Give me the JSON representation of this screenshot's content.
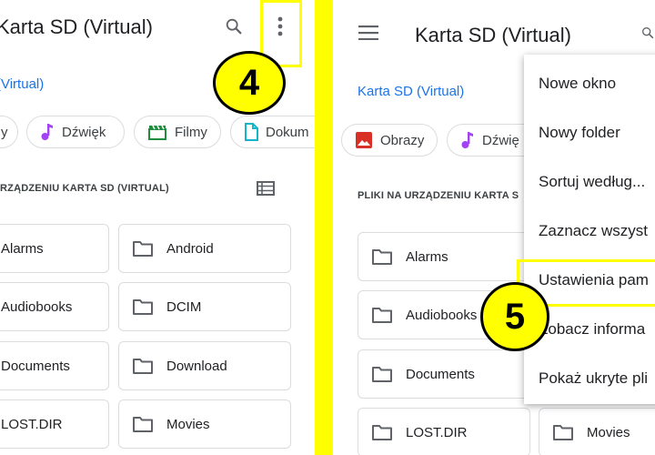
{
  "left": {
    "title": "Karta SD (Virtual)",
    "breadcrumb": "(Virtual)",
    "chips": [
      "y",
      "Dźwięk",
      "Filmy",
      "Dokum"
    ],
    "section_title": "RZĄDZENIU KARTA SD (VIRTUAL)",
    "folders": [
      "Alarms",
      "Android",
      "Audiobooks",
      "DCIM",
      "Documents",
      "Download",
      "LOST.DIR",
      "Movies"
    ],
    "callout": "4"
  },
  "right": {
    "title": "Karta SD (Virtual)",
    "breadcrumb": "Karta SD (Virtual)",
    "chips": [
      "Obrazy",
      "Dźwię"
    ],
    "section_title": "PLIKI NA URZĄDZENIU KARTA S",
    "folders": [
      "Alarms",
      "Audiobooks",
      "Documents",
      "LOST.DIR",
      "Movies"
    ],
    "callout": "5",
    "menu": [
      "Nowe okno",
      "Nowy folder",
      "Sortuj według...",
      "Zaznacz wszyst",
      "Ustawienia pam",
      "Zobacz informa",
      "Pokaż ukryte pli"
    ]
  },
  "colors": {
    "accent": "#1a73e8",
    "callout": "#ffff00",
    "audio_icon": "#a142f4",
    "video_icon": "#1e8e3e",
    "doc_icon": "#12b5cb",
    "image_icon": "#d93025"
  },
  "icons": [
    "search-icon",
    "more-vert-icon",
    "hamburger-icon",
    "list-view-icon",
    "folder-icon",
    "music-note-icon",
    "film-icon",
    "document-icon",
    "image-icon"
  ]
}
